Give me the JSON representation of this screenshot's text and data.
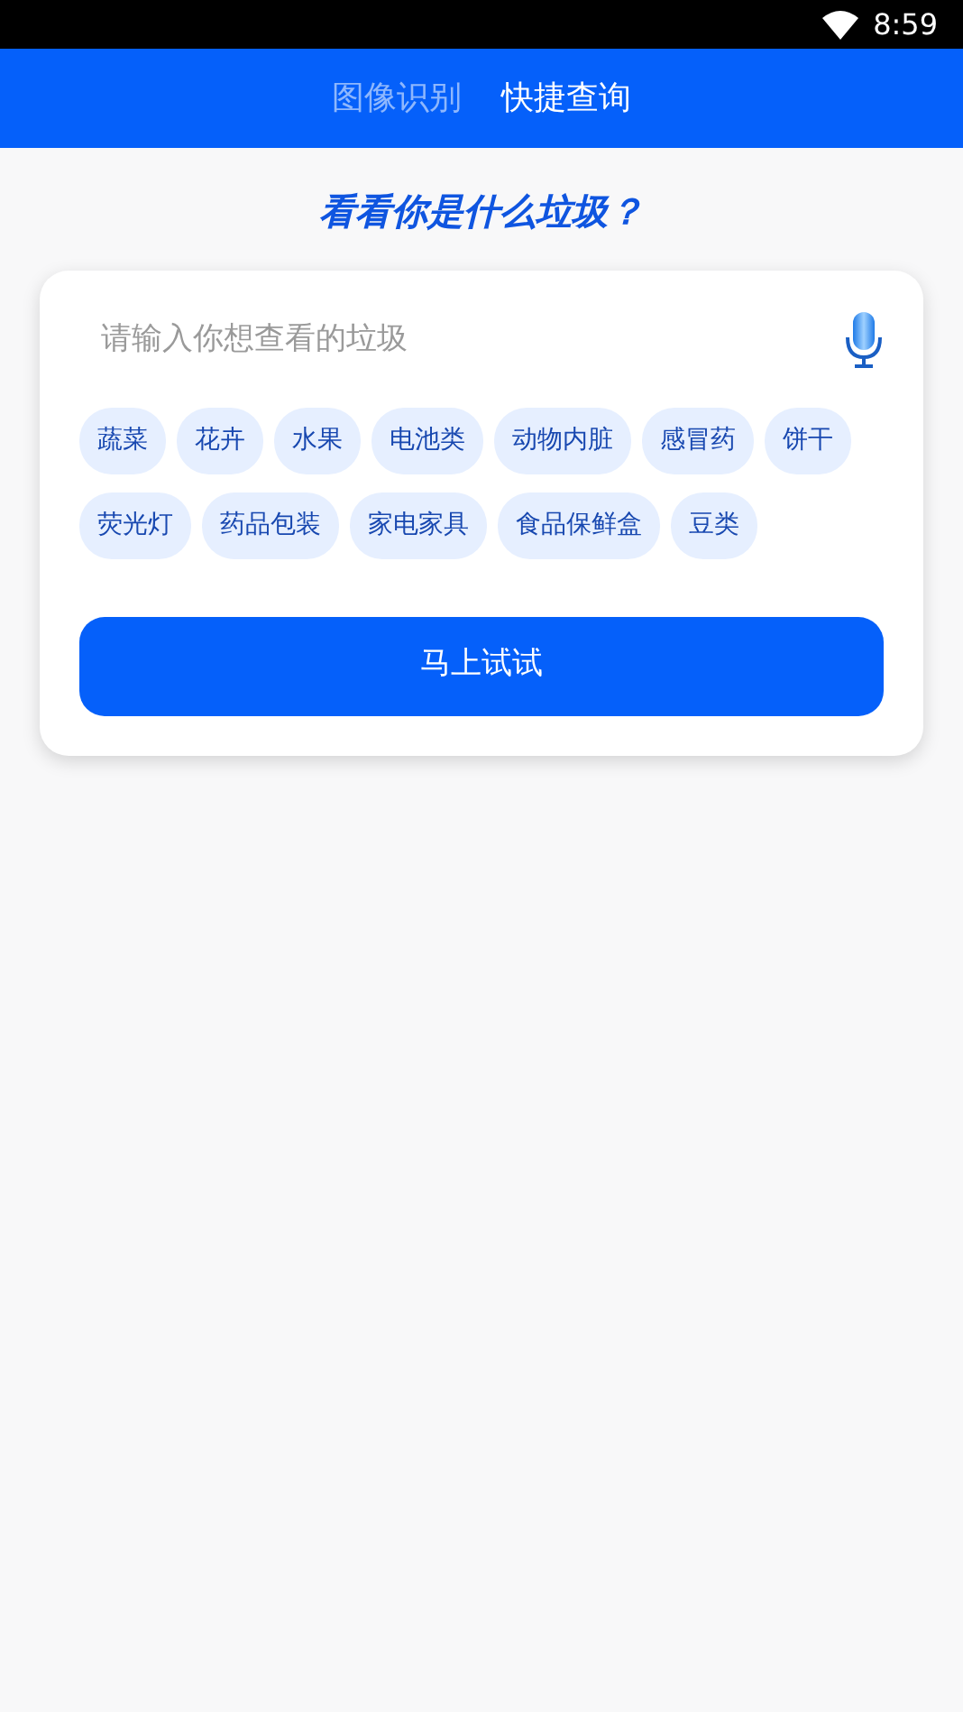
{
  "status_bar": {
    "time": "8:59"
  },
  "tabs": [
    {
      "label": "图像识别",
      "selected": false
    },
    {
      "label": "快捷查询",
      "selected": true
    }
  ],
  "heading": "看看你是什么垃圾？",
  "search": {
    "placeholder": "请输入你想查看的垃圾"
  },
  "tags": [
    "蔬菜",
    "花卉",
    "水果",
    "电池类",
    "动物内脏",
    "感冒药",
    "饼干",
    "荧光灯",
    "药品包装",
    "家电家具",
    "食品保鲜盒",
    "豆类"
  ],
  "submit_button": "马上试试"
}
